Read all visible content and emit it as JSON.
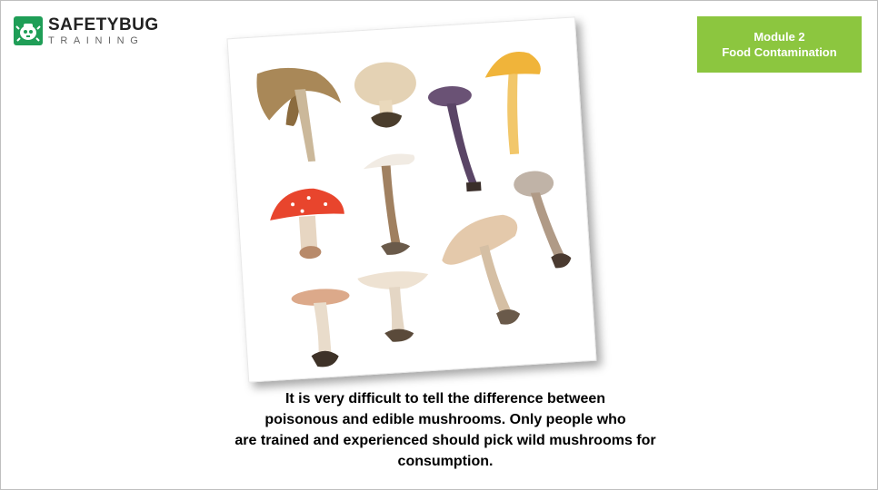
{
  "logo": {
    "title": "SAFETYBUG",
    "subtitle": "TRAINING",
    "icon": "bug-logo-icon"
  },
  "badge": {
    "line1": "Module 2",
    "line2": "Food Contamination",
    "color": "#8cc63f"
  },
  "image": {
    "subject": "mushroom-collection-photo"
  },
  "caption": {
    "lines": [
      "It is very difficult to tell the difference between",
      "poisonous and edible mushrooms. Only people who",
      "are trained and experienced should pick wild mushrooms for",
      "consumption."
    ]
  }
}
